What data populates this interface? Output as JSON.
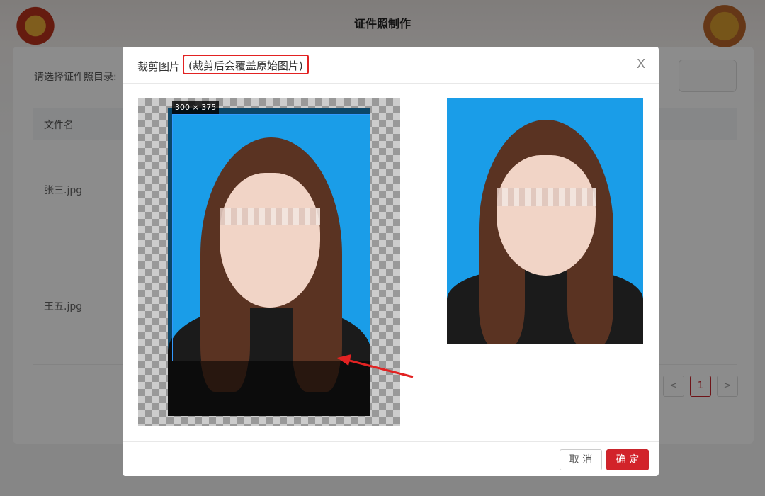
{
  "app": {
    "title": "证件照制作",
    "dir_label": "请选择证件照目录:",
    "table": {
      "header": "文件名",
      "rows": [
        "张三.jpg",
        "王五.jpg"
      ]
    },
    "pagination": {
      "prev": "<",
      "current": "1",
      "next": ">"
    }
  },
  "dialog": {
    "title": "裁剪图片",
    "note": "(裁剪后会覆盖原始图片)",
    "close": "X",
    "size_badge": "300 × 375",
    "cancel_label": "取 消",
    "ok_label": "确 定"
  },
  "colors": {
    "accent": "#d2232a",
    "photo_background": "#1a9de8",
    "highlight_border": "#e22222",
    "arrow": "#e22222"
  }
}
